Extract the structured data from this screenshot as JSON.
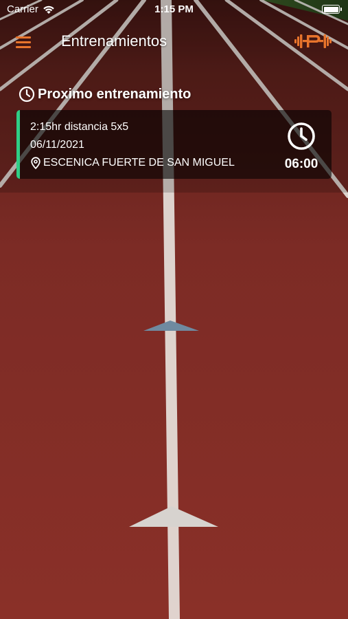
{
  "status_bar": {
    "carrier": "Carrier",
    "time": "1:15 PM"
  },
  "nav": {
    "title": "Entrenamientos",
    "menu_icon": "hamburger-menu-icon",
    "logo_icon": "barbell-logo-icon"
  },
  "section": {
    "title": "Proximo entrenamiento",
    "icon": "clock-icon"
  },
  "next_training": {
    "name": "2:15hr distancia 5x5",
    "date": "06/11/2021",
    "location": "ESCENICA FUERTE DE SAN MIGUEL",
    "time": "06:00",
    "location_icon": "location-pin-icon",
    "time_icon": "clock-icon"
  },
  "colors": {
    "accent": "#e8742c",
    "card_border": "#2fcf86",
    "track": "#7a2a24",
    "card_bg": "rgba(0,0,0,0.58)"
  }
}
